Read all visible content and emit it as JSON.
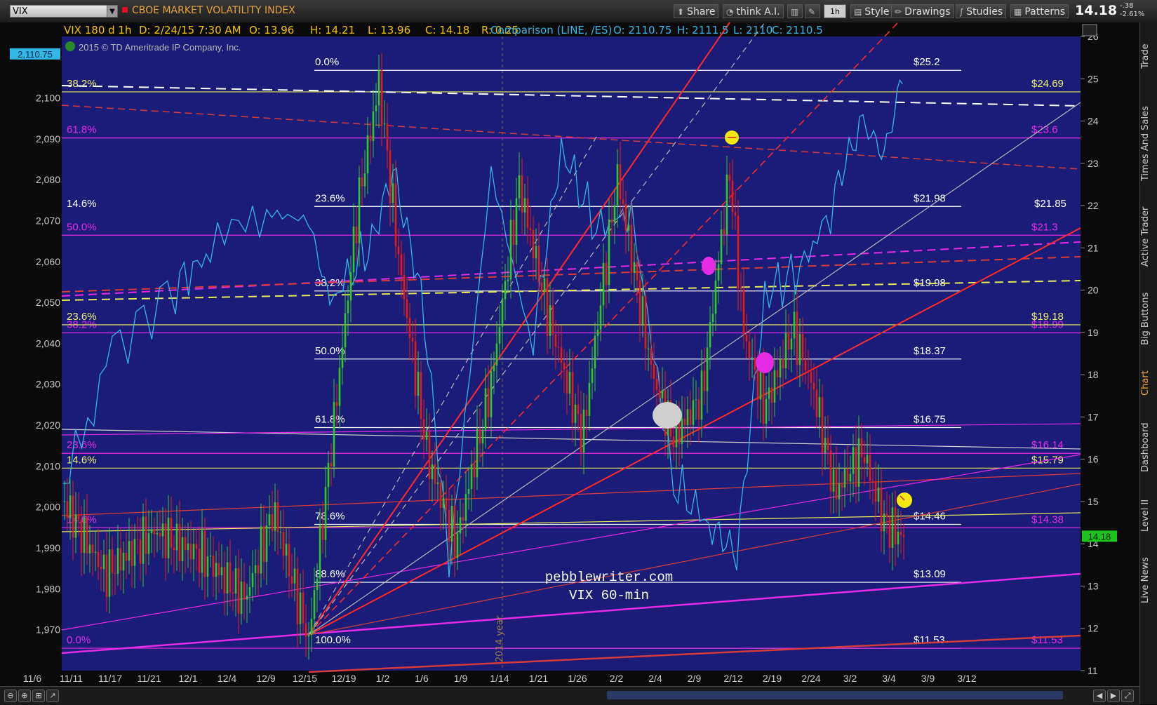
{
  "toolbar": {
    "symbol": "VIX",
    "title": "CBOE MARKET VOLATILITY INDEX",
    "buttons": [
      "Share",
      "think A.I.",
      "1h",
      "Style",
      "Drawings",
      "Studies",
      "Patterns"
    ],
    "last": "14.18",
    "change": "-.38",
    "change_pct": "-2.61%",
    "colors": {
      "title": "#e7a23c",
      "brand": "#d12"
    }
  },
  "side_tabs": [
    "Trade",
    "Times And Sales",
    "Active Trader",
    "Big Buttons",
    "Chart",
    "Dashboard",
    "Level II",
    "Live News"
  ],
  "active_tab": "Chart",
  "info_bar": {
    "sym": "VIX 180 d 1h",
    "date": "D: 2/24/15 7:30 AM",
    "o": "O: 13.96",
    "h": "H: 14.21",
    "l": "L: 13.96",
    "c": "C: 14.18",
    "r": "R: 0.25",
    "cmp": "Comparison (LINE, /ES)",
    "co": "O: 2110.75",
    "ch": "H: 2111.5",
    "cl": "L: 2110",
    "cc": "C: 2110.5"
  },
  "copyright": "2015 © TD Ameritrade IP Company, Inc.",
  "watermark": [
    "pebblewriter.com",
    "VIX 60-min"
  ],
  "year_marker": "2014 year",
  "chart_data": {
    "type": "line",
    "xlabels": [
      "11/6",
      "11/11",
      "11/17",
      "11/21",
      "12/1",
      "12/4",
      "12/9",
      "12/15",
      "12/19",
      "1/2",
      "1/6",
      "1/9",
      "1/14",
      "1/21",
      "1/26",
      "2/2",
      "2/4",
      "2/9",
      "2/12",
      "2/19",
      "2/24",
      "3/2",
      "3/4",
      "3/9",
      "3/12"
    ],
    "right_axis": {
      "label": "VIX",
      "ylim": [
        11,
        26
      ],
      "ticks": [
        11,
        12,
        13,
        14,
        15,
        16,
        17,
        18,
        19,
        20,
        21,
        22,
        23,
        24,
        25,
        26
      ]
    },
    "left_axis": {
      "label": "/ES",
      "ylim": [
        1960,
        2115
      ],
      "ticks": [
        "1,970",
        "1,980",
        "1,990",
        "2,000",
        "2,010",
        "2,020",
        "2,030",
        "2,040",
        "2,050",
        "2,060",
        "2,070",
        "2,080",
        "2,090",
        "2,100"
      ]
    },
    "left_current": "2,110.75",
    "right_current": "14.18",
    "series": [
      {
        "name": "VIX",
        "style": "candles",
        "color": "#31c631",
        "down_color": "#e21b1b"
      },
      {
        "name": "/ES",
        "style": "line",
        "color": "#33b7e6"
      }
    ],
    "fib_white": [
      {
        "pct": "0.0%",
        "price": "$25.2",
        "v": 25.2
      },
      {
        "pct": "23.6%",
        "price": "$21.98",
        "v": 21.98
      },
      {
        "pct": "38.2%",
        "price": "$19.98",
        "v": 19.98
      },
      {
        "pct": "50.0%",
        "price": "$18.37",
        "v": 18.37
      },
      {
        "pct": "61.8%",
        "price": "$16.75",
        "v": 16.75
      },
      {
        "pct": "78.6%",
        "price": "$14.46",
        "v": 14.46
      },
      {
        "pct": "88.6%",
        "price": "$13.09",
        "v": 13.09
      },
      {
        "pct": "100.0%",
        "price": "$11.53",
        "v": 11.53
      }
    ],
    "fib_magenta": [
      {
        "pct": "61.8%",
        "price": "$23.6",
        "v": 23.6
      },
      {
        "pct": "50.0%",
        "price": "$21.3",
        "v": 21.3
      },
      {
        "pct": "38.2%",
        "price": "$18.99",
        "v": 18.99
      },
      {
        "pct": "23.6%",
        "price": "$16.14",
        "v": 16.14
      },
      {
        "pct": "14.6%",
        "price": "$14.38",
        "v": 14.38
      },
      {
        "pct": "0.0%",
        "price": "$11.53",
        "v": 11.53
      }
    ],
    "fib_yellow": [
      {
        "pct": "38.2%",
        "price": "$24.69",
        "v": 24.69
      },
      {
        "pct": "23.6%",
        "price": "$19.18",
        "v": 19.18
      },
      {
        "pct": "14.6%",
        "price": "$15.79",
        "v": 15.79
      }
    ],
    "extra_labels": [
      {
        "pct": "14.6%",
        "price": "$21.85",
        "v": 21.85
      }
    ]
  }
}
